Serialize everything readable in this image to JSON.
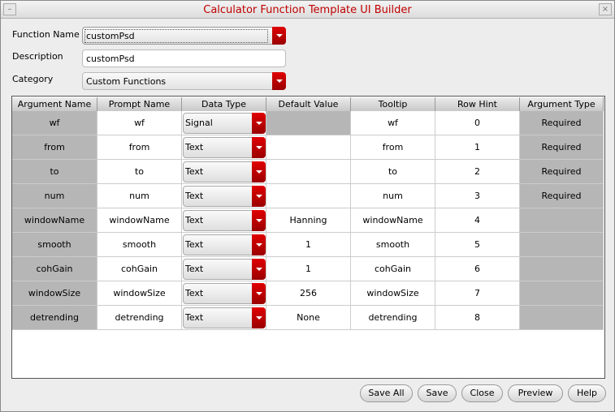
{
  "window": {
    "title": "Calculator Function Template UI Builder"
  },
  "form": {
    "function_name_label": "Function Name",
    "function_name": "customPsd",
    "description_label": "Description",
    "description": "customPsd",
    "category_label": "Category",
    "category": "Custom Functions"
  },
  "table": {
    "headers": [
      "Argument Name",
      "Prompt Name",
      "Data Type",
      "Default Value",
      "Tooltip",
      "Row Hint",
      "Argument Type"
    ],
    "rows": [
      [
        "wf",
        "wf",
        "Signal",
        "",
        "wf",
        "0",
        "Required"
      ],
      [
        "from",
        "from",
        "Text",
        "",
        "from",
        "1",
        "Required"
      ],
      [
        "to",
        "to",
        "Text",
        "",
        "to",
        "2",
        "Required"
      ],
      [
        "num",
        "num",
        "Text",
        "",
        "num",
        "3",
        "Required"
      ],
      [
        "windowName",
        "windowName",
        "Text",
        "Hanning",
        "windowName",
        "4",
        ""
      ],
      [
        "smooth",
        "smooth",
        "Text",
        "1",
        "smooth",
        "5",
        ""
      ],
      [
        "cohGain",
        "cohGain",
        "Text",
        "1",
        "cohGain",
        "6",
        ""
      ],
      [
        "windowSize",
        "windowSize",
        "Text",
        "256",
        "windowSize",
        "7",
        ""
      ],
      [
        "detrending",
        "detrending",
        "Text",
        "None",
        "detrending",
        "8",
        ""
      ]
    ]
  },
  "buttons": {
    "save_all": "Save All",
    "save": "Save",
    "close": "Close",
    "preview": "Preview",
    "help": "Help"
  }
}
